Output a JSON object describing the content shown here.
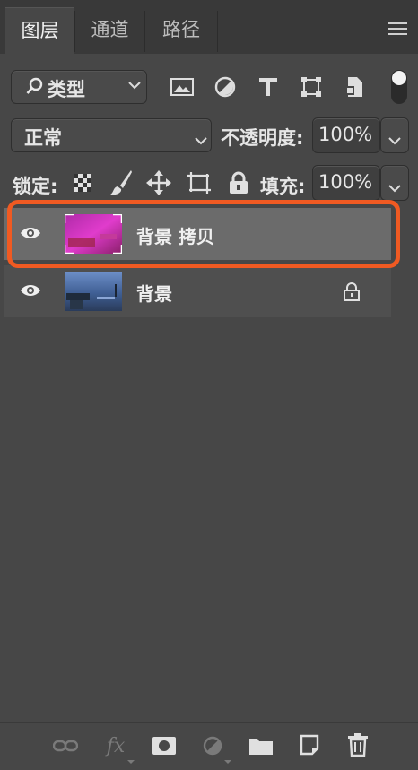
{
  "tabs": [
    {
      "label": "图层",
      "active": true
    },
    {
      "label": "通道",
      "active": false
    },
    {
      "label": "路径",
      "active": false
    }
  ],
  "panel_menu_icon": "hamburger-menu-icon",
  "filter": {
    "kind_label": "类型",
    "icons": [
      "image-filter-icon",
      "adjustment-filter-icon",
      "type-filter-icon",
      "shape-filter-icon",
      "smart-object-filter-icon"
    ],
    "toggle_icon": "filter-toggle-icon"
  },
  "blend": {
    "mode": "正常",
    "opacity_label": "不透明度:",
    "opacity_value": "100%"
  },
  "lock": {
    "label": "锁定:",
    "icons": [
      "lock-transparent-pixels-icon",
      "lock-image-pixels-icon",
      "lock-position-icon",
      "lock-artboard-icon",
      "lock-all-icon"
    ],
    "fill_label": "填充:",
    "fill_value": "100%"
  },
  "layers": [
    {
      "name": "背景 拷贝",
      "visible": true,
      "selected": true,
      "locked": false,
      "highlighted": true
    },
    {
      "name": "背景",
      "visible": true,
      "selected": false,
      "locked": true,
      "highlighted": false
    }
  ],
  "colors": {
    "panel_bg": "#474747",
    "selected_row": "#6b6b6b",
    "highlight_box": "#f05a22"
  },
  "footer_icons": [
    "link-layers-icon",
    "layer-style-fx-icon",
    "add-mask-icon",
    "adjustment-layer-icon",
    "new-group-folder-icon",
    "new-layer-icon",
    "delete-layer-trash-icon"
  ]
}
